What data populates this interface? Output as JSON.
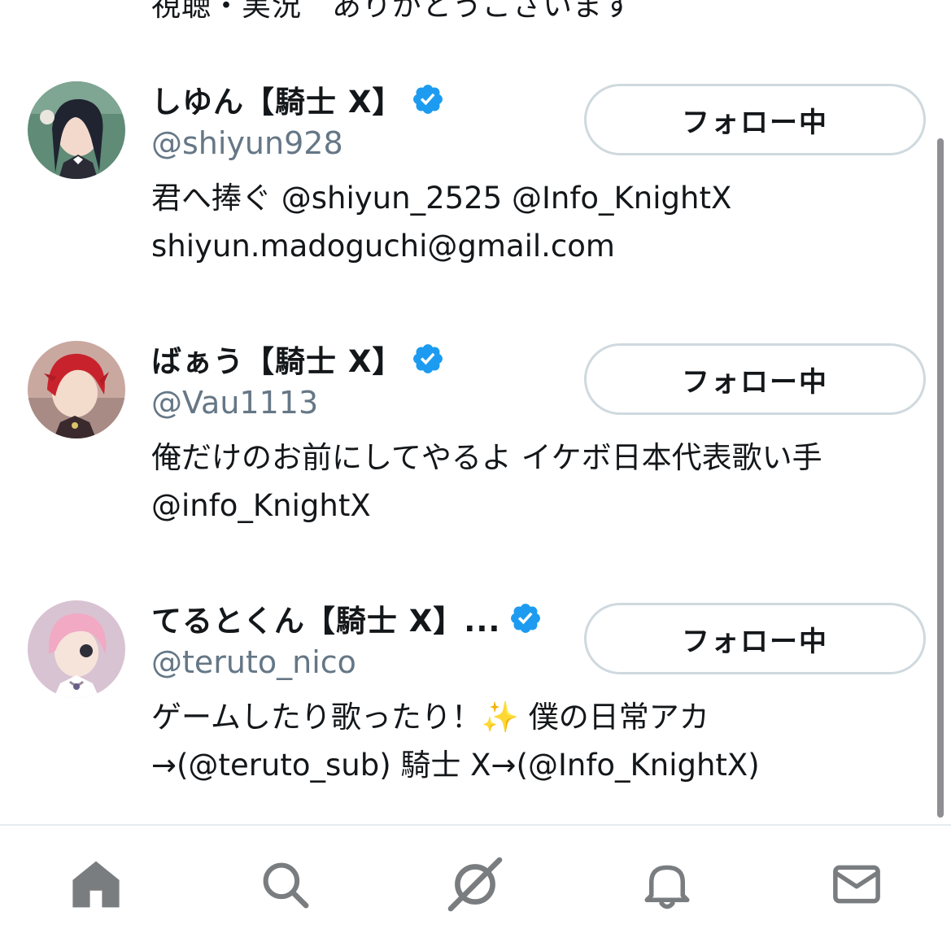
{
  "top_fragment": "視聴・実況　ありがとうございます",
  "users": [
    {
      "display_name": "しゆん【騎士 X】",
      "handle": "@shiyun928",
      "bio": "君へ捧ぐ @shiyun_2525 @Info_KnightX\nshiyun.madoguchi@gmail.com",
      "follow_label": "フォロー中",
      "avatar_colors": {
        "bg": "#5f8b77",
        "hair": "#1f2430",
        "skin": "#f3d9cc"
      }
    },
    {
      "display_name": "ばぁう【騎士 X】",
      "handle": "@Vau1113",
      "bio": "俺だけのお前にしてやるよ イケボ日本代表歌い手\n @info_KnightX",
      "follow_label": "フォロー中",
      "avatar_colors": {
        "bg": "#c9a8a0",
        "hair": "#c8232c",
        "skin": "#f4dccd"
      }
    },
    {
      "display_name": "てるとくん【騎士 X】...",
      "handle": "@teruto_nico",
      "bio": "ゲームしたり歌ったり！✨ 僕の日常アカ\n→(@teruto_sub) 騎士 X→(@Info_KnightX)",
      "follow_label": "フォロー中",
      "avatar_colors": {
        "bg": "#d8c3d2",
        "hair": "#f2a9c4",
        "skin": "#f6e3da"
      }
    }
  ],
  "tabs": [
    "home-icon",
    "search-icon",
    "spaces-icon",
    "notifications-icon",
    "messages-icon"
  ],
  "colors": {
    "verified": "#1d9bf0",
    "handle_gray": "#657786",
    "button_border": "#cfd9de",
    "tab_icon_gray": "#7a7d80"
  }
}
